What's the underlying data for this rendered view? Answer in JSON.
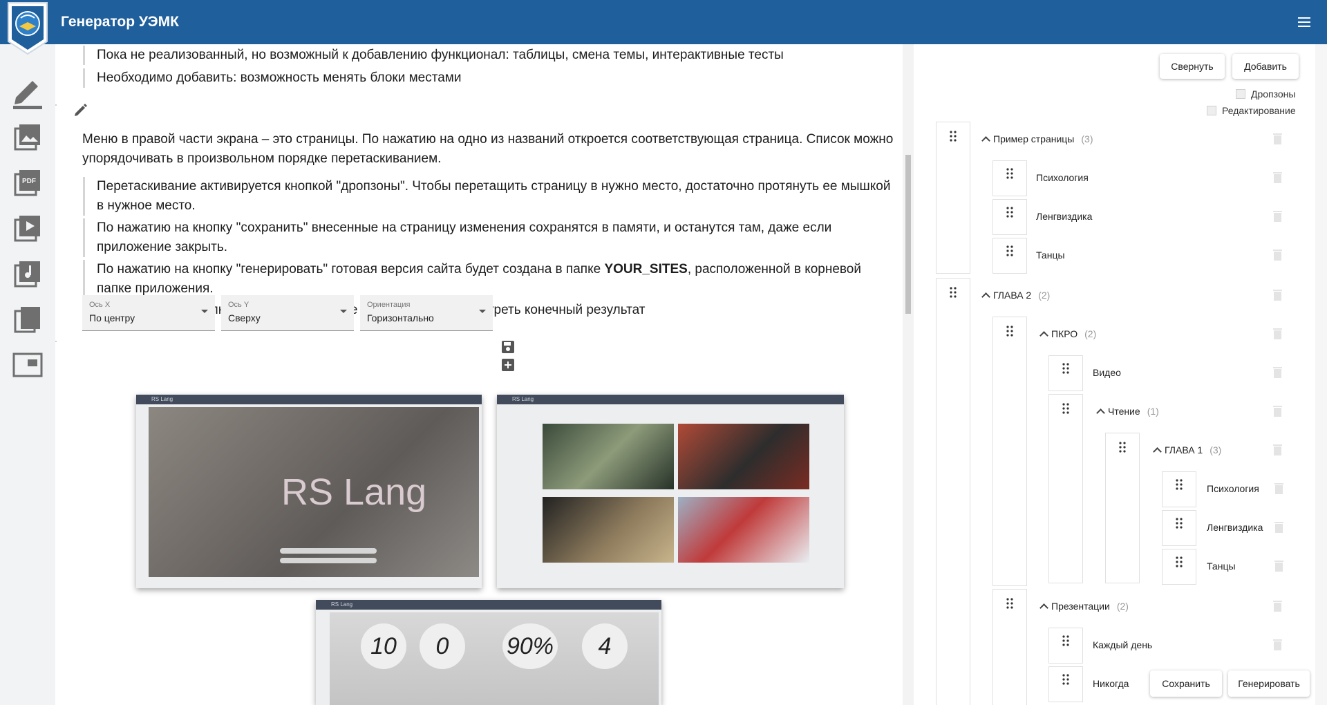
{
  "app": {
    "title": "Генератор УЭМК"
  },
  "content": {
    "quotes_top": [
      "Пока не реализованный, но возможный к добавлению функционал: таблицы, смена темы, интерактивные тесты",
      "Необходимо добавить: возможность менять блоки местами"
    ],
    "menu_paragraph": "Меню в правой части экрана – это страницы. По нажатию на одно из названий откроется соответствующая страница. Список можно упорядочивать в произвольном порядке перетаскиванием.",
    "quote_drag": "Перетаскивание активируется кнопкой \"дропзоны\". Чтобы перетащить страницу в нужно место, достаточно протянуть ее мышкой в нужное место.",
    "quote_save": "По нажатию на кнопку \"сохранить\" внесенные на страницу изменения сохранятся в памяти, и останутся там, даже если приложение закрыть.",
    "quote_gen_before": "По нажатию на кнопку \"генерировать\" готовая версия сайта будет создана в папке ",
    "quote_gen_bold": "YOUR_SITES",
    "quote_gen_after": ", расположенной в корневой папке приложения.",
    "edit_toggle_text": "Можно включить/выключить редактирование для того, чтоб посмотреть конечный результат",
    "selects": [
      {
        "label": "Ось X",
        "value": "По центру"
      },
      {
        "label": "Ось Y",
        "value": "Сверху"
      },
      {
        "label": "Ориентация",
        "value": "Горизонтально"
      }
    ],
    "shots": {
      "bar_title": "RS Lang",
      "hero_title": "RS Lang",
      "stats": [
        "10",
        "0",
        "90%",
        "4"
      ]
    }
  },
  "panel": {
    "collapse": "Свернуть",
    "add": "Добавить",
    "dropzones": "Дропзоны",
    "editing": "Редактирование",
    "save": "Сохранить",
    "generate": "Генерировать",
    "tree": {
      "p1": {
        "title": "Пример страницы",
        "count": "(3)",
        "items": [
          "Психология",
          "Ленгвиздика",
          "Танцы"
        ]
      },
      "g2": {
        "title": "ГЛАВА 2",
        "count": "(2)"
      },
      "pkro": {
        "title": "ПКРО",
        "count": "(2)",
        "video": "Видео"
      },
      "reading": {
        "title": "Чтение",
        "count": "(1)"
      },
      "g1": {
        "title": "ГЛАВА 1",
        "count": "(3)",
        "items": [
          "Психология",
          "Ленгвиздика",
          "Танцы"
        ]
      },
      "pres": {
        "title": "Презентации",
        "count": "(2)",
        "items": [
          "Каждый день",
          "Никогда"
        ]
      }
    }
  }
}
